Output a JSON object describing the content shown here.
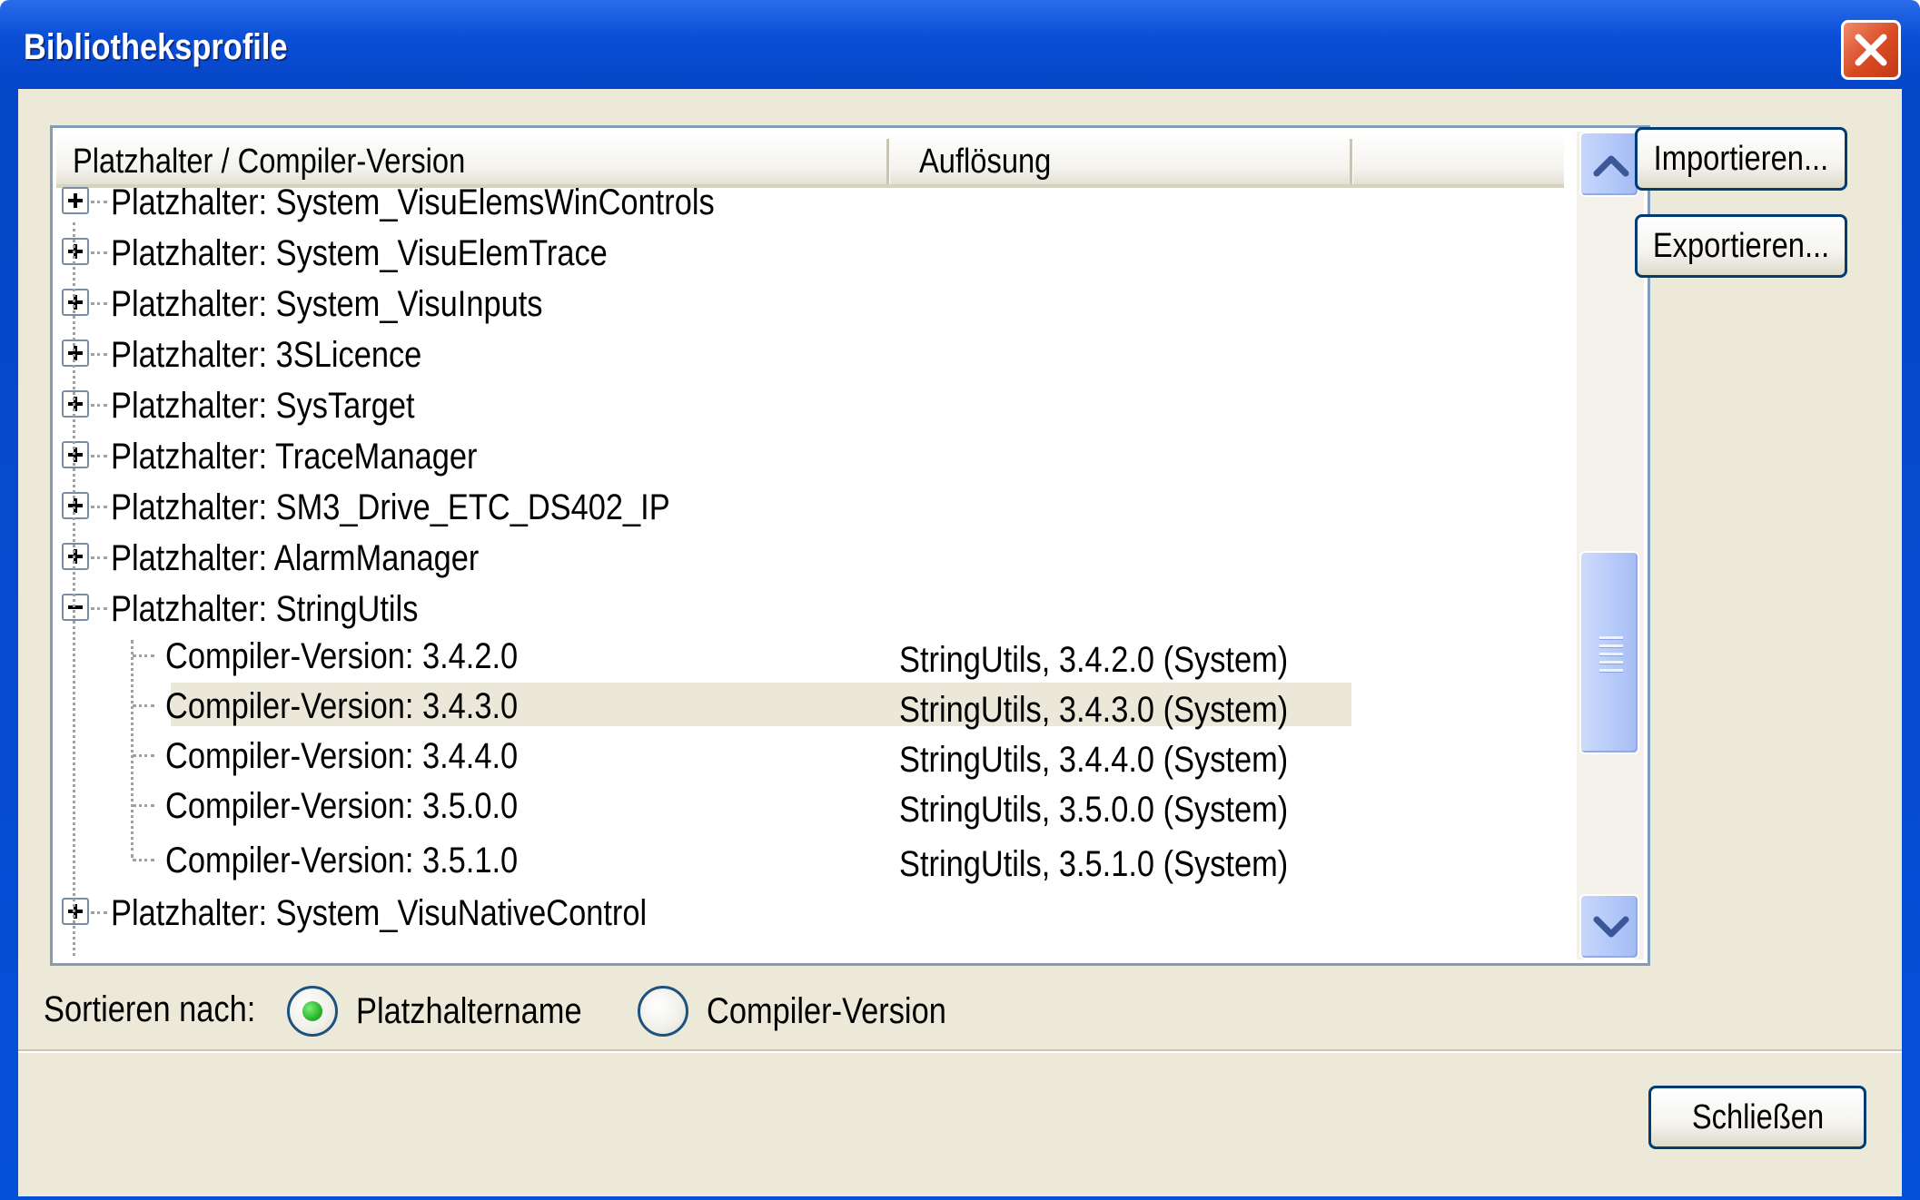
{
  "window": {
    "title": "Bibliotheksprofile"
  },
  "tree": {
    "columns": [
      "Platzhalter / Compiler-Version",
      "Auflösung"
    ],
    "rows": [
      {
        "label": "Platzhalter: System_VisuElemsWinControls",
        "resolution": "",
        "level": 0,
        "expander": "plus"
      },
      {
        "label": "Platzhalter: System_VisuElemTrace",
        "resolution": "",
        "level": 0,
        "expander": "plus"
      },
      {
        "label": "Platzhalter: System_VisuInputs",
        "resolution": "",
        "level": 0,
        "expander": "plus"
      },
      {
        "label": "Platzhalter: 3SLicence",
        "resolution": "",
        "level": 0,
        "expander": "plus"
      },
      {
        "label": "Platzhalter: SysTarget",
        "resolution": "",
        "level": 0,
        "expander": "plus"
      },
      {
        "label": "Platzhalter: TraceManager",
        "resolution": "",
        "level": 0,
        "expander": "plus"
      },
      {
        "label": "Platzhalter: SM3_Drive_ETC_DS402_IP",
        "resolution": "",
        "level": 0,
        "expander": "plus"
      },
      {
        "label": "Platzhalter: AlarmManager",
        "resolution": "",
        "level": 0,
        "expander": "plus"
      },
      {
        "label": "Platzhalter: StringUtils",
        "resolution": "",
        "level": 0,
        "expander": "minus"
      },
      {
        "label": "Compiler-Version: 3.4.2.0",
        "resolution": "StringUtils, 3.4.2.0 (System)",
        "level": 1,
        "expander": "none"
      },
      {
        "label": "Compiler-Version: 3.4.3.0",
        "resolution": "StringUtils, 3.4.3.0 (System)",
        "level": 1,
        "expander": "none",
        "selected": true
      },
      {
        "label": "Compiler-Version: 3.4.4.0",
        "resolution": "StringUtils, 3.4.4.0 (System)",
        "level": 1,
        "expander": "none"
      },
      {
        "label": "Compiler-Version: 3.5.0.0",
        "resolution": "StringUtils, 3.5.0.0 (System)",
        "level": 1,
        "expander": "none"
      },
      {
        "label": "Compiler-Version: 3.5.1.0",
        "resolution": "StringUtils, 3.5.1.0 (System)",
        "level": 1,
        "expander": "none"
      },
      {
        "label": "Platzhalter: System_VisuNativeControl",
        "resolution": "",
        "level": 0,
        "expander": "plus"
      }
    ]
  },
  "buttons": {
    "import_label": "Importieren...",
    "export_label": "Exportieren...",
    "close_label": "Schließen"
  },
  "sort": {
    "label": "Sortieren nach:",
    "options": [
      {
        "label": "Platzhaltername",
        "selected": true
      },
      {
        "label": "Compiler-Version",
        "selected": false
      }
    ]
  },
  "icons": {
    "close": "close-icon",
    "scroll_up": "chevron-up-icon",
    "scroll_down": "chevron-down-icon"
  }
}
